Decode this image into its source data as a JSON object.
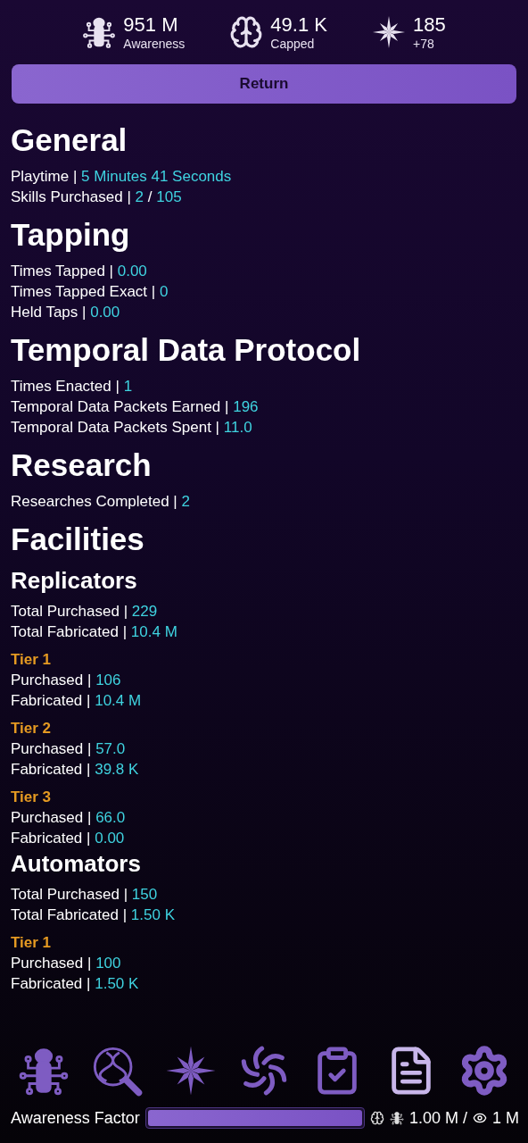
{
  "stats": [
    {
      "value": "951 M",
      "label": "Awareness"
    },
    {
      "value": "49.1 K",
      "label": "Capped"
    },
    {
      "value": "185",
      "label": "+78"
    }
  ],
  "return_button": "Return",
  "content": [
    {
      "kind": "h1",
      "text": "General"
    },
    {
      "kind": "stat",
      "parts": [
        {
          "kind": "label",
          "text": "Playtime |"
        },
        {
          "kind": "value",
          "text": "5 Minutes 41 Seconds"
        }
      ]
    },
    {
      "kind": "stat",
      "parts": [
        {
          "kind": "label",
          "text": "Skills Purchased |"
        },
        {
          "kind": "value",
          "text": "2"
        },
        {
          "kind": "label",
          "text": "/"
        },
        {
          "kind": "value",
          "text": "105"
        }
      ]
    },
    {
      "kind": "h1",
      "text": "Tapping"
    },
    {
      "kind": "stat",
      "parts": [
        {
          "kind": "label",
          "text": "Times Tapped |"
        },
        {
          "kind": "value",
          "text": "0.00"
        }
      ]
    },
    {
      "kind": "stat",
      "parts": [
        {
          "kind": "label",
          "text": "Times Tapped Exact |"
        },
        {
          "kind": "value",
          "text": "0"
        }
      ]
    },
    {
      "kind": "stat",
      "parts": [
        {
          "kind": "label",
          "text": "Held Taps |"
        },
        {
          "kind": "value",
          "text": "0.00"
        }
      ]
    },
    {
      "kind": "h1",
      "text": "Temporal Data Protocol"
    },
    {
      "kind": "stat",
      "parts": [
        {
          "kind": "label",
          "text": "Times Enacted |"
        },
        {
          "kind": "value",
          "text": "1"
        }
      ]
    },
    {
      "kind": "stat",
      "parts": [
        {
          "kind": "label",
          "text": "Temporal Data Packets Earned |"
        },
        {
          "kind": "value",
          "text": "196"
        }
      ]
    },
    {
      "kind": "stat",
      "parts": [
        {
          "kind": "label",
          "text": "Temporal Data Packets Spent |"
        },
        {
          "kind": "value",
          "text": "11.0"
        }
      ]
    },
    {
      "kind": "h1",
      "text": "Research"
    },
    {
      "kind": "stat",
      "parts": [
        {
          "kind": "label",
          "text": "Researches Completed |"
        },
        {
          "kind": "value",
          "text": "2"
        }
      ]
    },
    {
      "kind": "h1",
      "text": "Facilities"
    },
    {
      "kind": "h2",
      "text": "Replicators"
    },
    {
      "kind": "stat",
      "parts": [
        {
          "kind": "label",
          "text": "Total Purchased |"
        },
        {
          "kind": "value",
          "text": "229"
        }
      ]
    },
    {
      "kind": "stat",
      "parts": [
        {
          "kind": "label",
          "text": "Total Fabricated |"
        },
        {
          "kind": "value",
          "text": "10.4 M"
        }
      ]
    },
    {
      "kind": "h3",
      "text": "Tier 1"
    },
    {
      "kind": "stat",
      "parts": [
        {
          "kind": "label",
          "text": "Purchased |"
        },
        {
          "kind": "value",
          "text": "106"
        }
      ]
    },
    {
      "kind": "stat",
      "parts": [
        {
          "kind": "label",
          "text": "Fabricated |"
        },
        {
          "kind": "value",
          "text": "10.4 M"
        }
      ]
    },
    {
      "kind": "h3",
      "text": "Tier 2"
    },
    {
      "kind": "stat",
      "parts": [
        {
          "kind": "label",
          "text": "Purchased |"
        },
        {
          "kind": "value",
          "text": "57.0"
        }
      ]
    },
    {
      "kind": "stat",
      "parts": [
        {
          "kind": "label",
          "text": "Fabricated |"
        },
        {
          "kind": "value",
          "text": "39.8 K"
        }
      ]
    },
    {
      "kind": "h3",
      "text": "Tier 3"
    },
    {
      "kind": "stat",
      "parts": [
        {
          "kind": "label",
          "text": "Purchased |"
        },
        {
          "kind": "value",
          "text": "66.0"
        }
      ]
    },
    {
      "kind": "stat",
      "parts": [
        {
          "kind": "label",
          "text": "Fabricated |"
        },
        {
          "kind": "value",
          "text": "0.00"
        }
      ]
    },
    {
      "kind": "h2",
      "text": "Automators"
    },
    {
      "kind": "stat",
      "parts": [
        {
          "kind": "label",
          "text": "Total Purchased |"
        },
        {
          "kind": "value",
          "text": "150"
        }
      ]
    },
    {
      "kind": "stat",
      "parts": [
        {
          "kind": "label",
          "text": "Total Fabricated |"
        },
        {
          "kind": "value",
          "text": "1.50 K"
        }
      ]
    },
    {
      "kind": "h3",
      "text": "Tier 1"
    },
    {
      "kind": "stat",
      "parts": [
        {
          "kind": "label",
          "text": "Purchased |"
        },
        {
          "kind": "value",
          "text": "100"
        }
      ]
    },
    {
      "kind": "stat",
      "parts": [
        {
          "kind": "label",
          "text": "Fabricated |"
        },
        {
          "kind": "value",
          "text": "1.50 K"
        }
      ]
    }
  ],
  "awareness_factor": {
    "label": "Awareness Factor",
    "level": 1.0,
    "reading": "1.00 M /",
    "cap": "1 M"
  }
}
